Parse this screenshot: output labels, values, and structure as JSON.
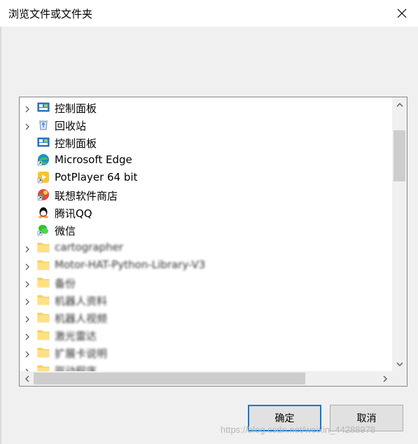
{
  "window": {
    "title": "浏览文件或文件夹"
  },
  "tree": {
    "items": [
      {
        "label": "控制面板",
        "icon": "control-panel-icon",
        "expandable": true,
        "blurred": false
      },
      {
        "label": "回收站",
        "icon": "recycle-bin-icon",
        "expandable": true,
        "blurred": false
      },
      {
        "label": "控制面板",
        "icon": "control-panel-icon",
        "expandable": false,
        "blurred": false
      },
      {
        "label": "Microsoft Edge",
        "icon": "edge-icon",
        "expandable": false,
        "blurred": false
      },
      {
        "label": "PotPlayer 64 bit",
        "icon": "potplayer-icon",
        "expandable": false,
        "blurred": false
      },
      {
        "label": "联想软件商店",
        "icon": "lenovo-store-icon",
        "expandable": false,
        "blurred": false
      },
      {
        "label": "腾讯QQ",
        "icon": "qq-icon",
        "expandable": false,
        "blurred": false
      },
      {
        "label": "微信",
        "icon": "wechat-icon",
        "expandable": false,
        "blurred": false
      },
      {
        "label": "cartographer",
        "icon": "folder-icon",
        "expandable": true,
        "blurred": true
      },
      {
        "label": "Motor-HAT-Python-Library-V3",
        "icon": "folder-icon",
        "expandable": true,
        "blurred": true
      },
      {
        "label": "备份",
        "icon": "folder-icon",
        "expandable": true,
        "blurred": true
      },
      {
        "label": "机器人资料",
        "icon": "folder-icon",
        "expandable": true,
        "blurred": true
      },
      {
        "label": "机器人视频",
        "icon": "folder-icon",
        "expandable": true,
        "blurred": true
      },
      {
        "label": "激光雷达",
        "icon": "folder-icon",
        "expandable": true,
        "blurred": true
      },
      {
        "label": "扩展卡说明",
        "icon": "folder-icon",
        "expandable": true,
        "blurred": true
      },
      {
        "label": "驱动程序",
        "icon": "folder-icon",
        "expandable": true,
        "blurred": true
      }
    ]
  },
  "buttons": {
    "ok_label": "确定",
    "cancel_label": "取消"
  },
  "watermark": "https://blog.csdn.net/weixin_44288978",
  "colors": {
    "accent": "#0078d7",
    "folder": "#ffd35c",
    "thumb": "#cdcdcd"
  }
}
